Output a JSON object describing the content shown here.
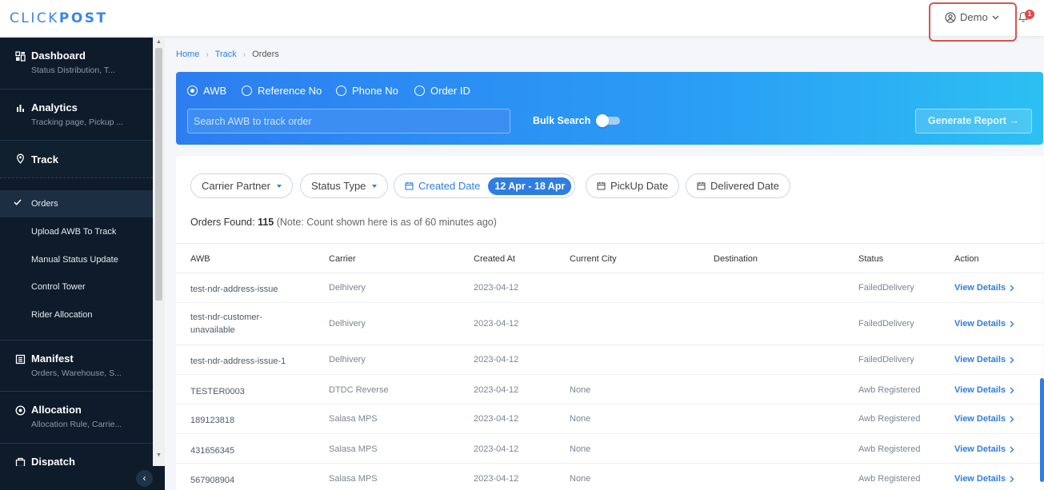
{
  "header": {
    "logo": {
      "part1": "CLICK",
      "part2": "POST"
    },
    "user_label": "Demo",
    "notification_count": "1"
  },
  "sidebar": {
    "sections": [
      {
        "title": "Dashboard",
        "subtitle": "Status Distribution, T...",
        "icon": "dashboard-icon"
      },
      {
        "title": "Analytics",
        "subtitle": "Tracking page, Pickup ...",
        "icon": "bar-chart-icon"
      },
      {
        "title": "Track",
        "subtitle": "",
        "icon": "location-pin-icon"
      },
      {
        "title": "Manifest",
        "subtitle": "Orders, Warehouse, S...",
        "icon": "manifest-icon"
      },
      {
        "title": "Allocation",
        "subtitle": "Allocation Rule, Carrie...",
        "icon": "target-icon"
      },
      {
        "title": "Dispatch",
        "subtitle": "",
        "icon": "dispatch-icon"
      }
    ],
    "track_items": [
      {
        "label": "Orders",
        "active": true
      },
      {
        "label": "Upload AWB To Track",
        "active": false
      },
      {
        "label": "Manual Status Update",
        "active": false
      },
      {
        "label": "Control Tower",
        "active": false
      },
      {
        "label": "Rider Allocation",
        "active": false
      }
    ]
  },
  "breadcrumb": {
    "home": "Home",
    "track": "Track",
    "current": "Orders"
  },
  "search": {
    "options": [
      "AWB",
      "Reference No",
      "Phone No",
      "Order ID"
    ],
    "selected": "AWB",
    "placeholder": "Search AWB to track order",
    "bulk_label": "Bulk Search",
    "generate_label": "Generate Report →"
  },
  "filters": {
    "carrier": "Carrier Partner",
    "status": "Status Type",
    "created": "Created Date",
    "created_range": "12 Apr - 18 Apr",
    "pickup": "PickUp Date",
    "delivered": "Delivered Date"
  },
  "summary": {
    "label": "Orders Found:",
    "count": "115",
    "note": "(Note: Count shown here is as of 60 minutes ago)"
  },
  "table": {
    "headers": [
      "AWB",
      "Carrier",
      "Created At",
      "Current City",
      "Destination",
      "Status",
      "Action"
    ],
    "action_label": "View Details",
    "rows": [
      {
        "awb": "test-ndr-address-issue",
        "carrier": "Delhivery",
        "created": "2023-04-12",
        "city": "",
        "destination": "",
        "status": "FailedDelivery"
      },
      {
        "awb": "test-ndr-customer-unavailable",
        "carrier": "Delhivery",
        "created": "2023-04-12",
        "city": "",
        "destination": "",
        "status": "FailedDelivery"
      },
      {
        "awb": "test-ndr-address-issue-1",
        "carrier": "Delhivery",
        "created": "2023-04-12",
        "city": "",
        "destination": "",
        "status": "FailedDelivery"
      },
      {
        "awb": "TESTER0003",
        "carrier": "DTDC Reverse",
        "created": "2023-04-12",
        "city": "None",
        "destination": "",
        "status": "Awb Registered"
      },
      {
        "awb": "189123818",
        "carrier": "Salasa MPS",
        "created": "2023-04-12",
        "city": "None",
        "destination": "",
        "status": "Awb Registered"
      },
      {
        "awb": "431656345",
        "carrier": "Salasa MPS",
        "created": "2023-04-12",
        "city": "None",
        "destination": "",
        "status": "Awb Registered"
      },
      {
        "awb": "567908904",
        "carrier": "Salasa MPS",
        "created": "2023-04-12",
        "city": "None",
        "destination": "",
        "status": "Awb Registered"
      }
    ]
  }
}
